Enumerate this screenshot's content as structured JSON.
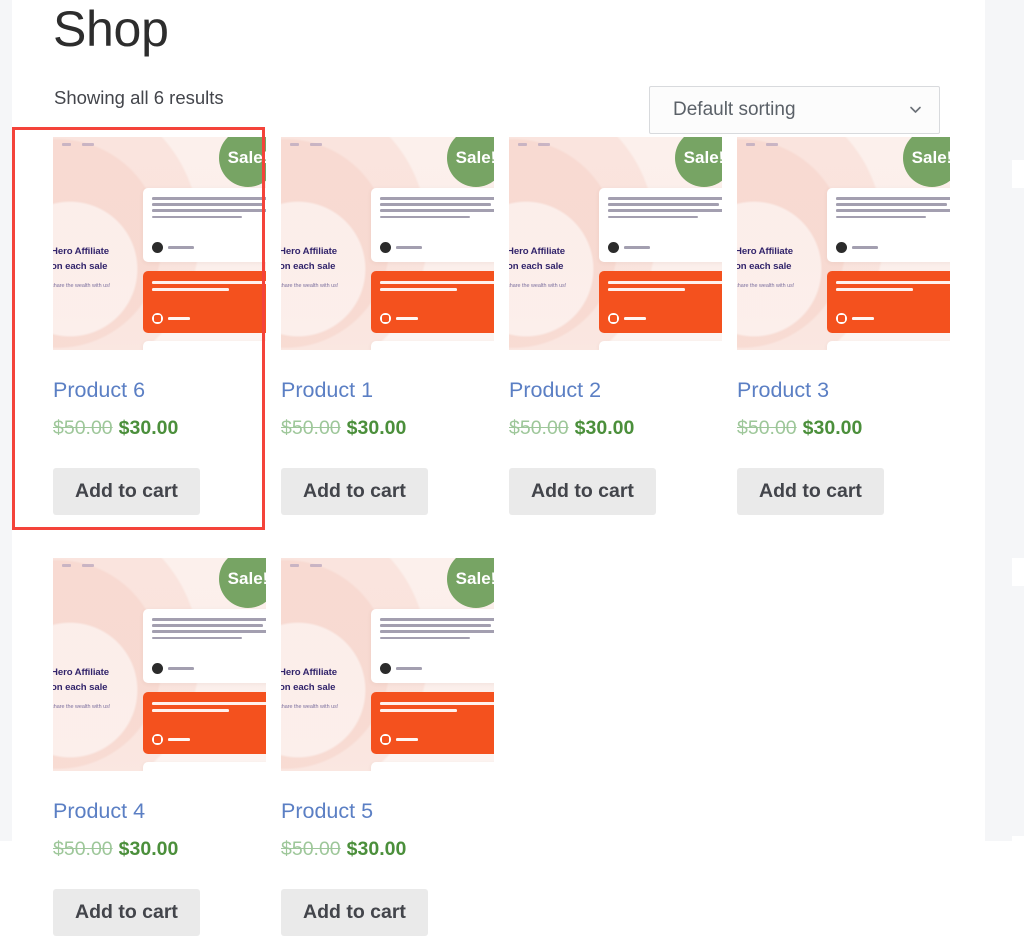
{
  "page": {
    "title": "Shop",
    "result_count": "Showing all 6 results"
  },
  "ordering": {
    "selected": "Default sorting",
    "chevron_icon": "chevron-down-icon"
  },
  "labels": {
    "sale_badge": "Sale!",
    "add_to_cart": "Add to cart"
  },
  "thumbnail": {
    "hero_line1": "Hero Affiliate",
    "hero_line2": "on each sale",
    "hero_sub": "share the wealth with us!"
  },
  "colors": {
    "sale_badge_bg": "#77a464",
    "product_title": "#5b7fc4",
    "price_regular": "#9ec79a",
    "price_sale": "#4b8f3b",
    "button_bg": "#eaeaea",
    "highlight_border": "#f4433a",
    "thumb_orange_card": "#f4511e",
    "thumb_background": "#fbeeea"
  },
  "products": [
    {
      "name": "Product 6",
      "regular_price": "$50.00",
      "sale_price": "$30.00",
      "on_sale": true,
      "add_to_cart": "Add to cart",
      "highlighted": true
    },
    {
      "name": "Product 1",
      "regular_price": "$50.00",
      "sale_price": "$30.00",
      "on_sale": true,
      "add_to_cart": "Add to cart",
      "highlighted": false
    },
    {
      "name": "Product 2",
      "regular_price": "$50.00",
      "sale_price": "$30.00",
      "on_sale": true,
      "add_to_cart": "Add to cart",
      "highlighted": false
    },
    {
      "name": "Product 3",
      "regular_price": "$50.00",
      "sale_price": "$30.00",
      "on_sale": true,
      "add_to_cart": "Add to cart",
      "highlighted": false
    },
    {
      "name": "Product 4",
      "regular_price": "$50.00",
      "sale_price": "$30.00",
      "on_sale": true,
      "add_to_cart": "Add to cart",
      "highlighted": false
    },
    {
      "name": "Product 5",
      "regular_price": "$50.00",
      "sale_price": "$30.00",
      "on_sale": true,
      "add_to_cart": "Add to cart",
      "highlighted": false
    }
  ]
}
